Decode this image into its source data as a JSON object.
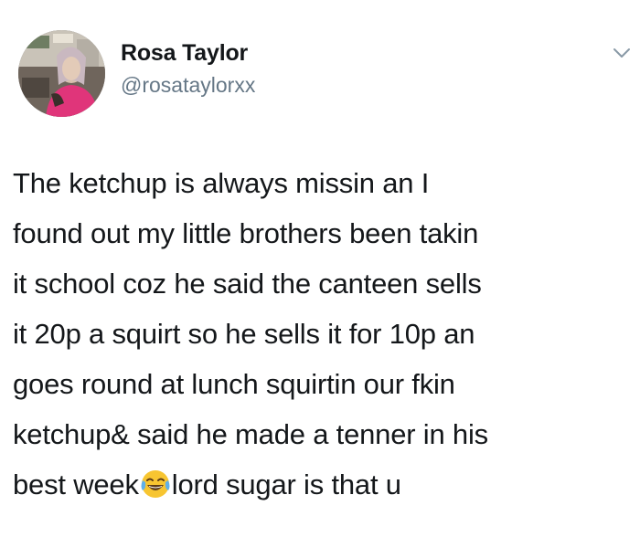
{
  "user": {
    "display_name": "Rosa Taylor",
    "handle": "@rosataylorxx"
  },
  "tweet": {
    "lines": [
      "The ketchup is always missin an I",
      "found out my little brothers been takin",
      "it school coz he said the canteen sells",
      "it 20p a squirt so he sells it for 10p an",
      "goes round at lunch squirtin our fkin",
      "ketchup& said he made a tenner in his"
    ],
    "last_line_before_emoji": "best week",
    "emoji": "face-with-tears-of-joy",
    "last_line_after_emoji": "lord sugar is that u"
  },
  "icons": {
    "menu": "chevron-down-icon"
  }
}
